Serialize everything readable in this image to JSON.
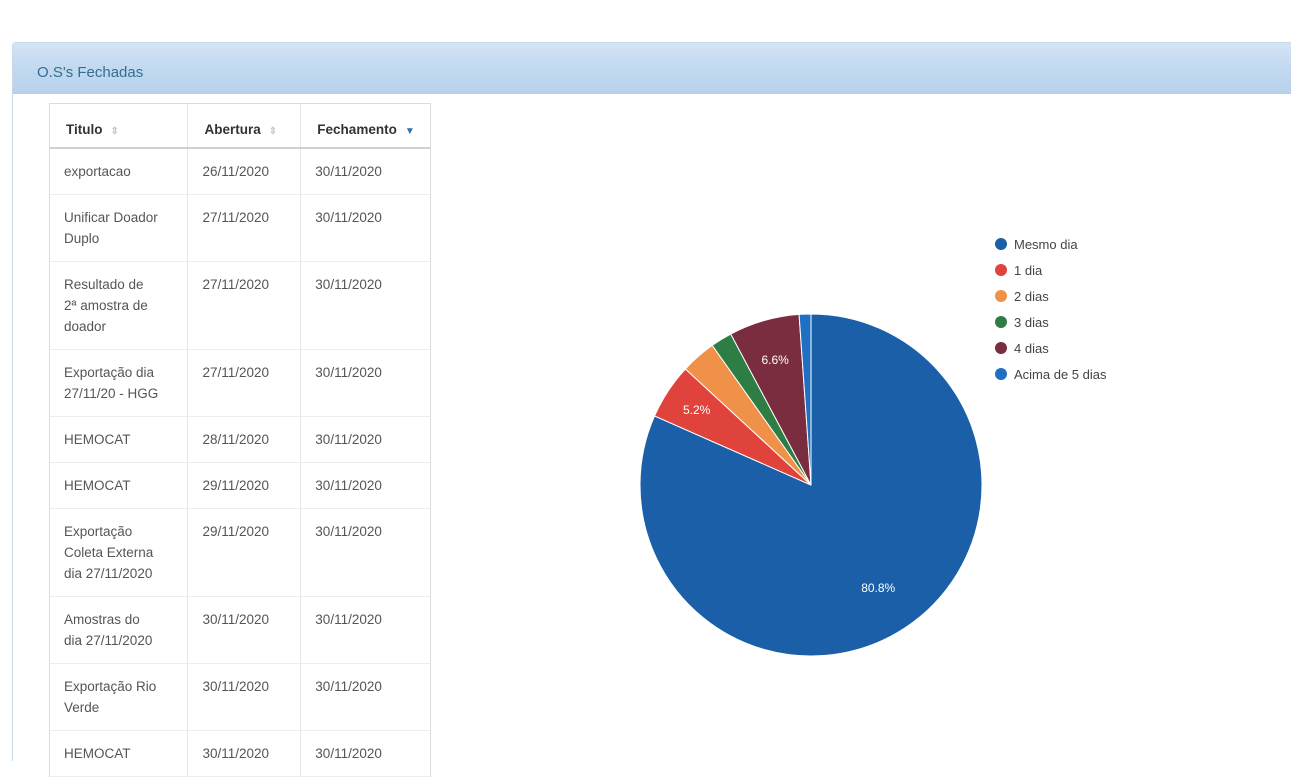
{
  "panel": {
    "title": "O.S's Fechadas"
  },
  "table": {
    "headers": [
      "Titulo",
      "Abertura",
      "Fechamento"
    ],
    "rows": [
      {
        "title": [
          "exportacao"
        ],
        "abertura": "26/11/2020",
        "fechamento": "30/11/2020"
      },
      {
        "title": [
          "Unificar Doador",
          "Duplo"
        ],
        "abertura": "27/11/2020",
        "fechamento": "30/11/2020"
      },
      {
        "title": [
          "Resultado de",
          "2ª amostra de",
          "doador"
        ],
        "abertura": "27/11/2020",
        "fechamento": "30/11/2020"
      },
      {
        "title": [
          "Exportação dia",
          "27/11/20 - HGG"
        ],
        "abertura": "27/11/2020",
        "fechamento": "30/11/2020"
      },
      {
        "title": [
          "HEMOCAT"
        ],
        "abertura": "28/11/2020",
        "fechamento": "30/11/2020"
      },
      {
        "title": [
          "HEMOCAT"
        ],
        "abertura": "29/11/2020",
        "fechamento": "30/11/2020"
      },
      {
        "title": [
          "Exportação",
          "Coleta Externa",
          "dia 27/11/2020"
        ],
        "abertura": "29/11/2020",
        "fechamento": "30/11/2020"
      },
      {
        "title": [
          "Amostras do",
          "dia 27/11/2020"
        ],
        "abertura": "30/11/2020",
        "fechamento": "30/11/2020"
      },
      {
        "title": [
          "Exportação Rio",
          "Verde"
        ],
        "abertura": "30/11/2020",
        "fechamento": "30/11/2020"
      },
      {
        "title": [
          "HEMOCAT"
        ],
        "abertura": "30/11/2020",
        "fechamento": "30/11/2020"
      }
    ]
  },
  "chart_data": {
    "type": "pie",
    "categories": [
      "Mesmo dia",
      "1 dia",
      "2 dias",
      "3 dias",
      "4 dias",
      "Acima de 5 dias"
    ],
    "values": [
      80.8,
      5.2,
      3.3,
      2.0,
      6.6,
      1.1
    ],
    "data_labels": [
      "80.8%",
      "5.2%",
      "",
      "",
      "6.6%",
      ""
    ],
    "colors": [
      "#1b5fa8",
      "#e0433c",
      "#f0914a",
      "#2e7d45",
      "#7a2d3f",
      "#1f6fc2"
    ],
    "legend_position": "right"
  }
}
